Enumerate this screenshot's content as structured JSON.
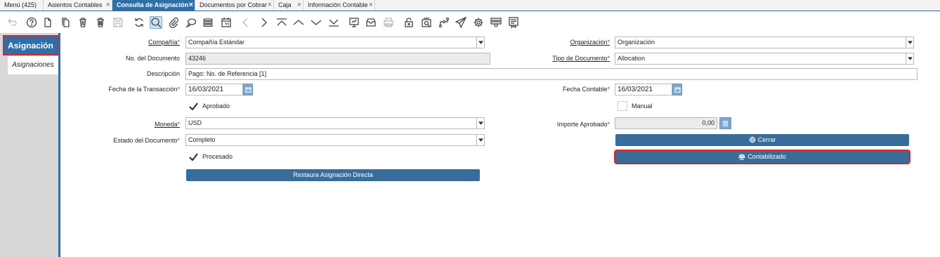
{
  "tabs": [
    {
      "label": "Menú (425)",
      "closable": false
    },
    {
      "label": "Asientos Contables",
      "closable": true
    },
    {
      "label": "Consulta de Asignación",
      "closable": true,
      "active": true
    },
    {
      "label": "Documentos por Cobrar",
      "closable": true
    },
    {
      "label": "Caja",
      "closable": true
    },
    {
      "label": "Información Contable",
      "closable": true
    }
  ],
  "toolbar_icons": [
    "undo-icon",
    "help-icon",
    "new-record-icon",
    "copy-record-icon",
    "delete-icon",
    "delete-selection-icon",
    "save-icon",
    "refresh-icon",
    "find-icon",
    "attachment-icon",
    "chat-icon",
    "grid-toggle-icon",
    "calendar-icon",
    "previous-record-icon",
    "next-record-icon",
    "first-record-icon",
    "parent-record-icon",
    "detail-record-icon",
    "last-record-icon",
    "report-icon",
    "archive-icon",
    "print-icon",
    "lock-icon",
    "zoom-across-icon",
    "workflow-icon",
    "send-icon",
    "process-icon",
    "product-info-icon",
    "archived-documents-icon"
  ],
  "side": {
    "main": "Asignación",
    "sub": "Asignaciones"
  },
  "form": {
    "company_label": "Compañía",
    "company_value": "Compañía Estándar",
    "org_label": "Organización",
    "org_value": "Organización",
    "docno_label": "No. del Documento",
    "docno_value": "43246",
    "doctype_label": "Tipo de Documento",
    "doctype_value": "Allocation",
    "desc_label": "Descripción",
    "desc_value": "Pago: No. de Referencia [1]",
    "trxdate_label": "Fecha de la Transacción",
    "trxdate_value": "16/03/2021",
    "acctdate_label": "Fecha Contable",
    "acctdate_value": "16/03/2021",
    "approved_label": "Aprobado",
    "manual_label": "Manual",
    "currency_label": "Moneda",
    "currency_value": "USD",
    "approved_amt_label": "Importe Aprobado",
    "approved_amt_value": "0,00",
    "status_label": "Estado del Documento",
    "status_value": "Completo",
    "close_button": "Cerrar",
    "posted_button": "Contabilizado",
    "processed_label": "Procesado",
    "reset_button": "Restaura Asignación Directa",
    "required_mark": "*"
  }
}
